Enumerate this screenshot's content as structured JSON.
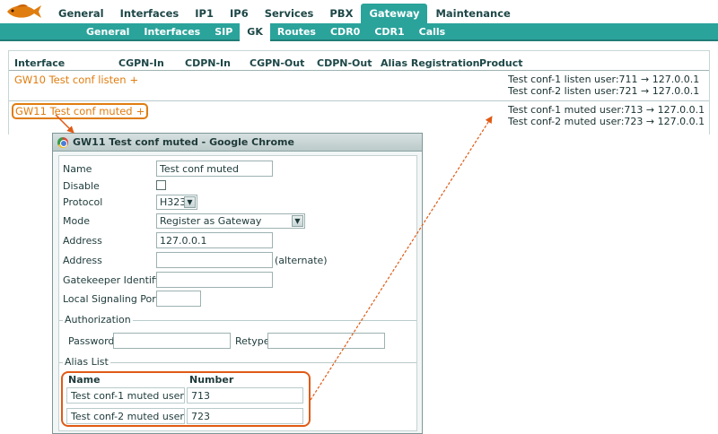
{
  "top_nav": {
    "items": [
      {
        "label": "General",
        "active": false
      },
      {
        "label": "Interfaces",
        "active": false
      },
      {
        "label": "IP1",
        "active": false
      },
      {
        "label": "IP6",
        "active": false
      },
      {
        "label": "Services",
        "active": false
      },
      {
        "label": "PBX",
        "active": false
      },
      {
        "label": "Gateway",
        "active": true
      },
      {
        "label": "Maintenance",
        "active": false
      }
    ]
  },
  "sub_nav": {
    "items": [
      {
        "label": "General",
        "active": false
      },
      {
        "label": "Interfaces",
        "active": false
      },
      {
        "label": "SIP",
        "active": false
      },
      {
        "label": "GK",
        "active": true
      },
      {
        "label": "Routes",
        "active": false
      },
      {
        "label": "CDR0",
        "active": false
      },
      {
        "label": "CDR1",
        "active": false
      },
      {
        "label": "Calls",
        "active": false
      }
    ]
  },
  "table": {
    "headers": {
      "interface": "Interface",
      "cgpn_in": "CGPN-In",
      "cdpn_in": "CDPN-In",
      "cgpn_out": "CGPN-Out",
      "cdpn_out": "CDPN-Out",
      "alias_reg": "Alias Registration",
      "product": "Product"
    },
    "rows": [
      {
        "interface": "GW10 Test conf listen",
        "plus": "+",
        "aliases": [
          {
            "text": "Test conf-1 listen user:711",
            "arrow": "→",
            "addr": "127.0.0.1"
          },
          {
            "text": "Test conf-2 listen user:721",
            "arrow": "→",
            "addr": "127.0.0.1"
          }
        ]
      },
      {
        "interface": "GW11 Test conf muted",
        "plus": "+",
        "aliases": [
          {
            "text": "Test conf-1 muted user:713",
            "arrow": "→",
            "addr": "127.0.0.1"
          },
          {
            "text": "Test conf-2 muted user:723",
            "arrow": "→",
            "addr": "127.0.0.1"
          }
        ]
      }
    ]
  },
  "popup": {
    "title": "GW11 Test conf muted - Google Chrome",
    "fields": {
      "name_label": "Name",
      "name_value": "Test conf muted",
      "disable_label": "Disable",
      "protocol_label": "Protocol",
      "protocol_value": "H323",
      "mode_label": "Mode",
      "mode_value": "Register as Gateway",
      "address_label": "Address",
      "address_value": "127.0.0.1",
      "address2_label": "Address",
      "address2_value": "",
      "alternate_label": "(alternate)",
      "gk_id_label": "Gatekeeper Identifier",
      "gk_id_value": "",
      "lsp_label": "Local Signaling Port",
      "lsp_value": ""
    },
    "auth": {
      "section_label": "Authorization",
      "password_label": "Password",
      "password_value": "",
      "retype_label": "Retype",
      "retype_value": ""
    },
    "alias_list": {
      "section_label": "Alias List",
      "name_header": "Name",
      "number_header": "Number",
      "rows": [
        {
          "name": "Test conf-1 muted user",
          "number": "713"
        },
        {
          "name": "Test conf-2 muted user",
          "number": "723"
        }
      ]
    }
  },
  "colors": {
    "accent": "#2aa39b",
    "link": "#e07d10",
    "annotation": "#e05a14"
  },
  "icons": {
    "logo": "fish-logo-icon",
    "browser": "chrome-icon",
    "dropdown": "chevron-down-icon"
  }
}
